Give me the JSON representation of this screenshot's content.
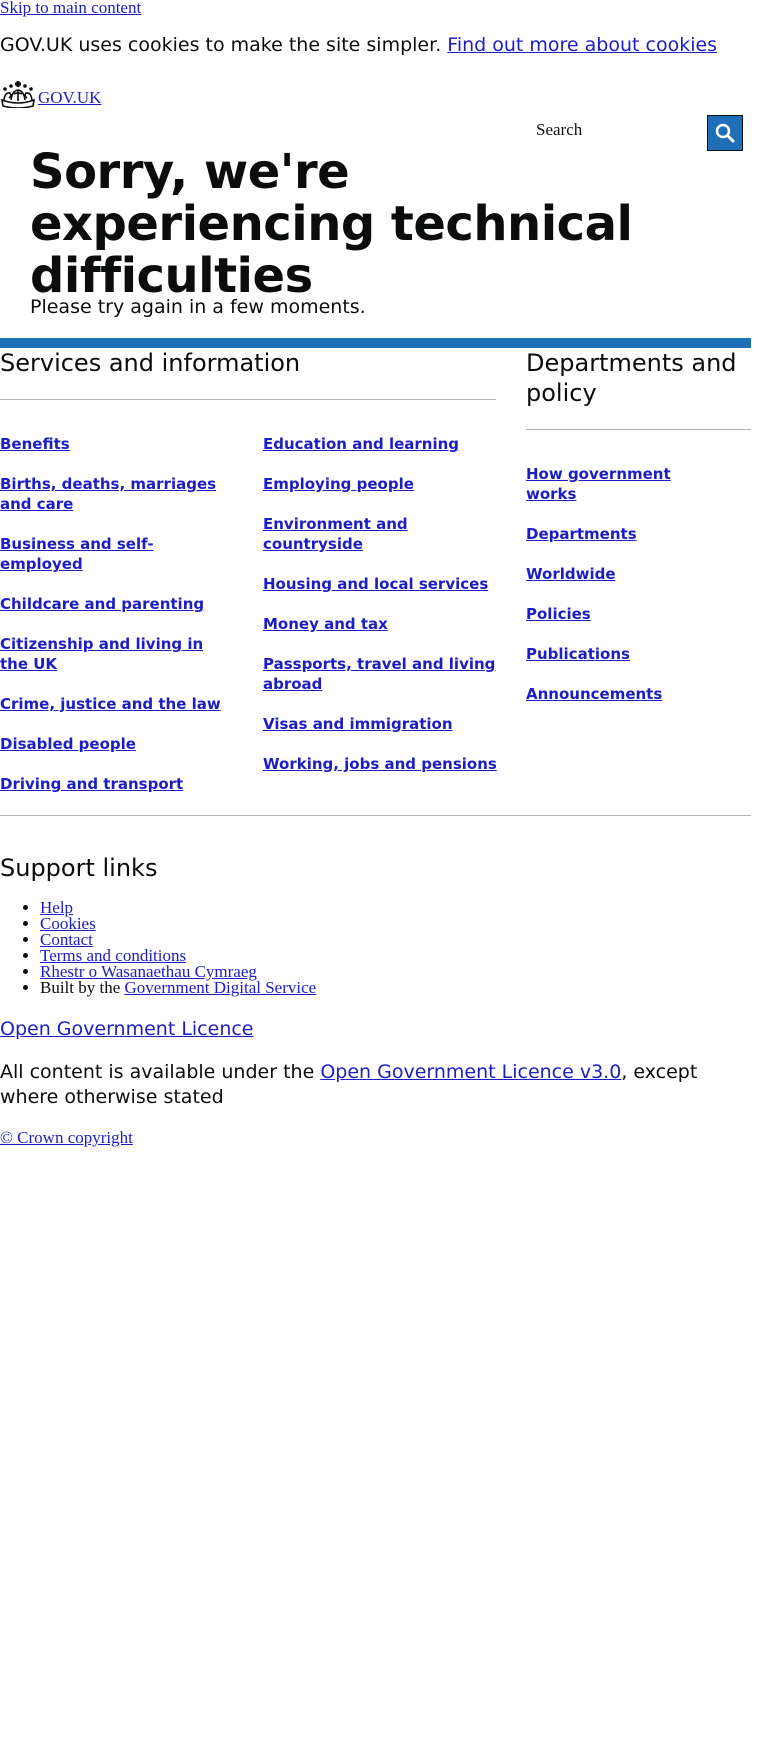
{
  "skip_link": "Skip to main content",
  "cookie_banner": {
    "text": "GOV.UK uses cookies to make the site simpler.",
    "link": "Find out more about cookies"
  },
  "header": {
    "logo_text": "GOV.UK",
    "logo_icon": "crown-icon",
    "search_label": "Search",
    "search_icon": "search-icon"
  },
  "main": {
    "title": "Sorry, we're experiencing technical difficulties",
    "message": "Please try again in a few moments."
  },
  "services": {
    "title": "Services and information",
    "col1": [
      "Benefits",
      "Births, deaths, marriages and care",
      "Business and self-employed",
      "Childcare and parenting",
      "Citizenship and living in the UK",
      "Crime, justice and the law",
      "Disabled people",
      "Driving and transport"
    ],
    "col2": [
      "Education and learning",
      "Employing people",
      "Environment and countryside",
      "Housing and local services",
      "Money and tax",
      "Passports, travel and living abroad",
      "Visas and immigration",
      "Working, jobs and pensions"
    ]
  },
  "departments": {
    "title": "Departments and policy",
    "items": [
      "How government works",
      "Departments",
      "Worldwide",
      "Policies",
      "Publications",
      "Announcements"
    ]
  },
  "support": {
    "title": "Support links",
    "items": [
      "Help",
      "Cookies",
      "Contact",
      "Terms and conditions",
      "Rhestr o Wasanaethau Cymraeg"
    ],
    "built_by_text": "Built by the",
    "built_by_link": "Government Digital Service"
  },
  "licence": {
    "logo_link": "Open Government Licence",
    "text_before": "All content is available under the",
    "link": "Open Government Licence v3.0",
    "text_after": ", except where otherwise stated"
  },
  "copyright": "© Crown copyright",
  "colors": {
    "brand_blue": "#1d70b8",
    "link": "#1d1dc4",
    "text": "#0b0c0c",
    "rule": "#b1b4b6"
  }
}
